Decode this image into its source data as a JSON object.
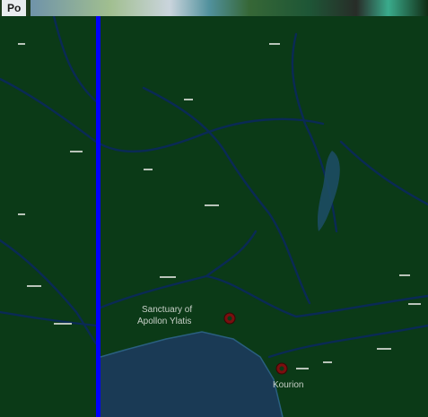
{
  "window": {
    "title_fragment": "Po"
  },
  "map": {
    "labels": {
      "sanctuary_line1": "Sanctuary of",
      "sanctuary_line2": "Apollon Ylatis",
      "kourion": "Kourion"
    },
    "markers": [
      {
        "name": "sanctuary-marker",
        "kind": "archaeological-site"
      },
      {
        "name": "kourion-marker",
        "kind": "archaeological-site"
      }
    ]
  },
  "colors": {
    "land": "#0b3a17",
    "sea": "#1a3a55",
    "roads": "#0a2a55",
    "highlight_line": "#0000ff",
    "marker_fill": "#7a0f0f"
  }
}
